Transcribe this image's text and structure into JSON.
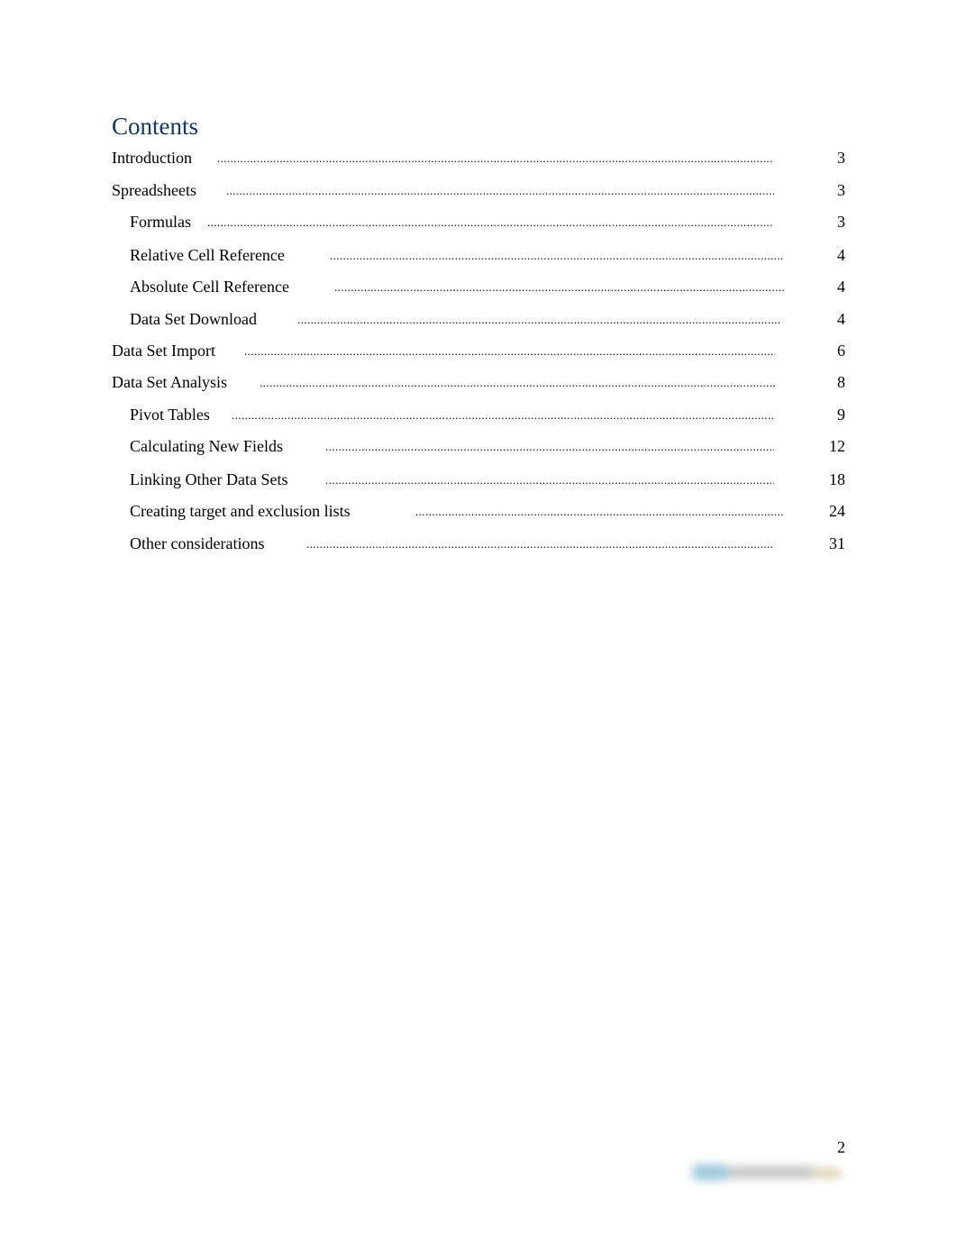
{
  "document": {
    "title": "Contents",
    "page_number": "2",
    "watermark": "blurred-logo"
  },
  "toc": [
    {
      "label": "Introduction",
      "page": "3",
      "level": 1
    },
    {
      "label": "Spreadsheets",
      "page": "3",
      "level": 1
    },
    {
      "label": "Formulas",
      "page": "3",
      "level": 2
    },
    {
      "label": "Relative Cell Reference",
      "page": "4",
      "level": 2
    },
    {
      "label": "Absolute Cell Reference",
      "page": "4",
      "level": 2
    },
    {
      "label": "Data Set Download",
      "page": "4",
      "level": 2
    },
    {
      "label": "Data Set Import",
      "page": "6",
      "level": 1
    },
    {
      "label": "Data Set Analysis",
      "page": "8",
      "level": 1
    },
    {
      "label": "Pivot Tables",
      "page": "9",
      "level": 2
    },
    {
      "label": "Calculating New Fields",
      "page": "12",
      "level": 2
    },
    {
      "label": "Linking Other Data Sets",
      "page": "18",
      "level": 2
    },
    {
      "label": "Creating target and exclusion lists",
      "page": "24",
      "level": 2
    },
    {
      "label": "Other considerations",
      "page": "31",
      "level": 2
    }
  ],
  "leader_char": "."
}
